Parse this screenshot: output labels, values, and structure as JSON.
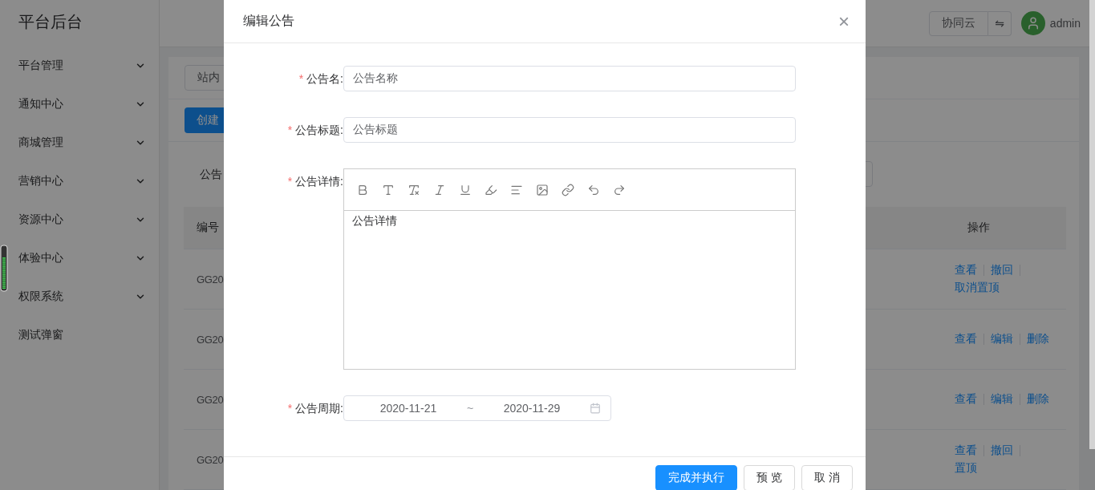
{
  "sidebar": {
    "title": "平台后台",
    "items": [
      {
        "label": "平台管理",
        "kind": "submenu"
      },
      {
        "label": "通知中心",
        "kind": "submenu"
      },
      {
        "label": "商城管理",
        "kind": "submenu"
      },
      {
        "label": "营销中心",
        "kind": "submenu"
      },
      {
        "label": "资源中心",
        "kind": "submenu"
      },
      {
        "label": "体验中心",
        "kind": "submenu"
      },
      {
        "label": "权限系统",
        "kind": "submenu"
      },
      {
        "label": "测试弹窗",
        "kind": "link"
      }
    ]
  },
  "header": {
    "tenant_button": "协同云",
    "switch_button": "⇋",
    "user": "admin"
  },
  "toolbar": {
    "tab": "站内",
    "create_button": "创建"
  },
  "filter": {
    "label": "公告"
  },
  "table": {
    "columns": [
      "编号",
      "操作"
    ],
    "rows": [
      {
        "cell": "GG20",
        "actions": [
          [
            "查看",
            "撤回"
          ],
          [
            "取消置顶"
          ]
        ]
      },
      {
        "cell": "GG20",
        "actions": [
          [
            "查看",
            "编辑",
            "删除"
          ]
        ]
      },
      {
        "cell": "GG20",
        "actions": [
          [
            "查看",
            "编辑",
            "删除"
          ]
        ]
      },
      {
        "cell": "GG20",
        "actions": [
          [
            "查看",
            "撤回"
          ],
          [
            "置顶"
          ]
        ]
      }
    ]
  },
  "dialog": {
    "title": "编辑公告",
    "close": "×",
    "fields": [
      {
        "kind": "input",
        "required_mark": "*",
        "label": "公告名:",
        "value": "公告名称"
      },
      {
        "kind": "input",
        "required_mark": "*",
        "label": "公告标题:",
        "value": "公告标题"
      },
      {
        "kind": "editor",
        "required_mark": "*",
        "label": "公告详情:",
        "value": "公告详情"
      },
      {
        "kind": "date_range",
        "required_mark": "*",
        "label": "公告周期:",
        "start": "2020-11-21",
        "separator": "~",
        "end": "2020-11-29"
      }
    ],
    "buttons": [
      {
        "label": "完成并执行",
        "primary": true
      },
      {
        "label": "预 览",
        "primary": false
      },
      {
        "label": "取 消",
        "primary": false
      }
    ]
  }
}
